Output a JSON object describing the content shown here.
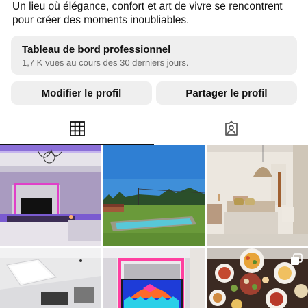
{
  "profile": {
    "bio_line1": "Un lieu où élégance, confort et art de vivre se rencontrent",
    "bio_line2": "pour créer des moments inoubliables."
  },
  "dashboard": {
    "title": "Tableau de bord professionnel",
    "subtitle": "1,7 K vues au cours des 30 derniers jours."
  },
  "actions": {
    "edit_label": "Modifier le profil",
    "share_label": "Partager le profil"
  },
  "tabs": [
    {
      "icon": "grid-icon",
      "selected": true
    },
    {
      "icon": "tagged-user-icon",
      "selected": false
    }
  ],
  "posts": [
    {
      "subject": "living room with purple LED lighting",
      "multi": false
    },
    {
      "subject": "garden swimming pool",
      "multi": false
    },
    {
      "subject": "bedroom with wicker lamp",
      "multi": false
    },
    {
      "subject": "white room with skylight",
      "multi": false
    },
    {
      "subject": "TV wall with pink LED lighting",
      "multi": false
    },
    {
      "subject": "buffet table of food",
      "multi": true
    }
  ],
  "colors": {
    "button_bg": "#efefef",
    "text": "#111111",
    "secondary_text": "#666666"
  }
}
